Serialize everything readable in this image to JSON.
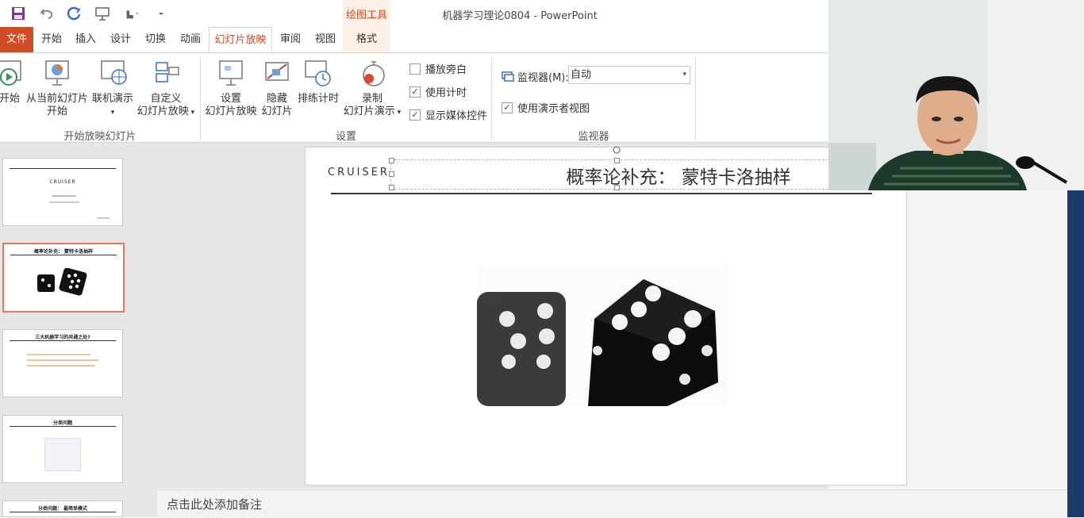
{
  "window": {
    "title": "机器学习理论0804 - PowerPoint",
    "context_tab_group": "绘图工具"
  },
  "tabs": [
    {
      "label": "文件"
    },
    {
      "label": "开始"
    },
    {
      "label": "插入"
    },
    {
      "label": "设计"
    },
    {
      "label": "切换"
    },
    {
      "label": "动画"
    },
    {
      "label": "幻灯片放映"
    },
    {
      "label": "审阅"
    },
    {
      "label": "视图"
    },
    {
      "label": "格式"
    }
  ],
  "ribbon": {
    "start_group": {
      "label": "开始放映幻灯片",
      "from_beginning": "开始",
      "from_current_1": "从当前幻灯片",
      "from_current_2": "开始",
      "online": "联机演示",
      "custom_1": "自定义",
      "custom_2": "幻灯片放映"
    },
    "setup_group": {
      "label": "设置",
      "setup_1": "设置",
      "setup_2": "幻灯片放映",
      "hide_1": "隐藏",
      "hide_2": "幻灯片",
      "rehearse": "排练计时",
      "record_1": "录制",
      "record_2": "幻灯片演示",
      "play_narrations": "播放旁白",
      "use_timings": "使用计时",
      "show_media_controls": "显示媒体控件",
      "play_narrations_checked": false,
      "use_timings_checked": true,
      "show_media_controls_checked": true
    },
    "monitor_group": {
      "label": "监视器",
      "monitor_label": "监视器(M):",
      "monitor_value": "自动",
      "presenter_view": "使用演示者视图",
      "presenter_view_checked": true
    }
  },
  "thumbnails": [
    {
      "title": "",
      "logo": "CRUISER"
    },
    {
      "title": "概率论补充：  蒙特卡洛抽样"
    },
    {
      "title": "三大机器学习的共通之处?"
    },
    {
      "title": "分类问题"
    },
    {
      "title": "分类问题：  最简单模式"
    }
  ],
  "slide": {
    "logo": "CRUISER",
    "title": "概率论补充：  蒙特卡洛抽样"
  },
  "notes": {
    "placeholder": "点击此处添加备注"
  },
  "colors": {
    "accent": "#d14b24",
    "file_tab": "#d14b24"
  }
}
